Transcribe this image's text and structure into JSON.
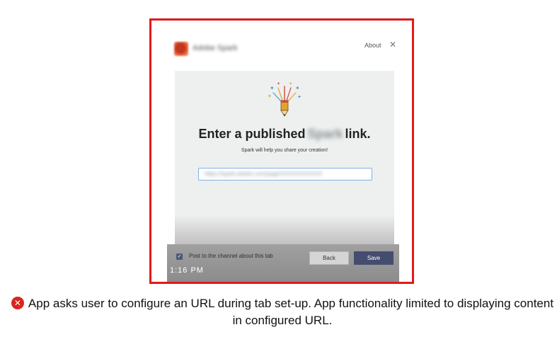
{
  "dialog": {
    "app_name": "Adobe Spark",
    "about_label": "About",
    "close_glyph": "✕",
    "card": {
      "title_prefix": "Enter a published",
      "title_blurred_word": "Spark",
      "title_suffix": "link.",
      "subtitle": "Spark will help you share your creation!",
      "url_value": "https://spark.adobe.com/page/XXXXXXXXXXX"
    },
    "footer": {
      "checkbox_label": "Post to the channel about this tab",
      "checkbox_checked": true,
      "back_label": "Back",
      "save_label": "Save",
      "watermark": "1:16 PM"
    }
  },
  "caption": {
    "text": "App asks user to configure an URL during tab set-up. App functionality limited to displaying content in configured URL."
  },
  "colors": {
    "frame_border": "#e11a1a",
    "save_button": "#454d6f",
    "error_icon": "#d7261e",
    "input_border": "#7fb0e3"
  }
}
